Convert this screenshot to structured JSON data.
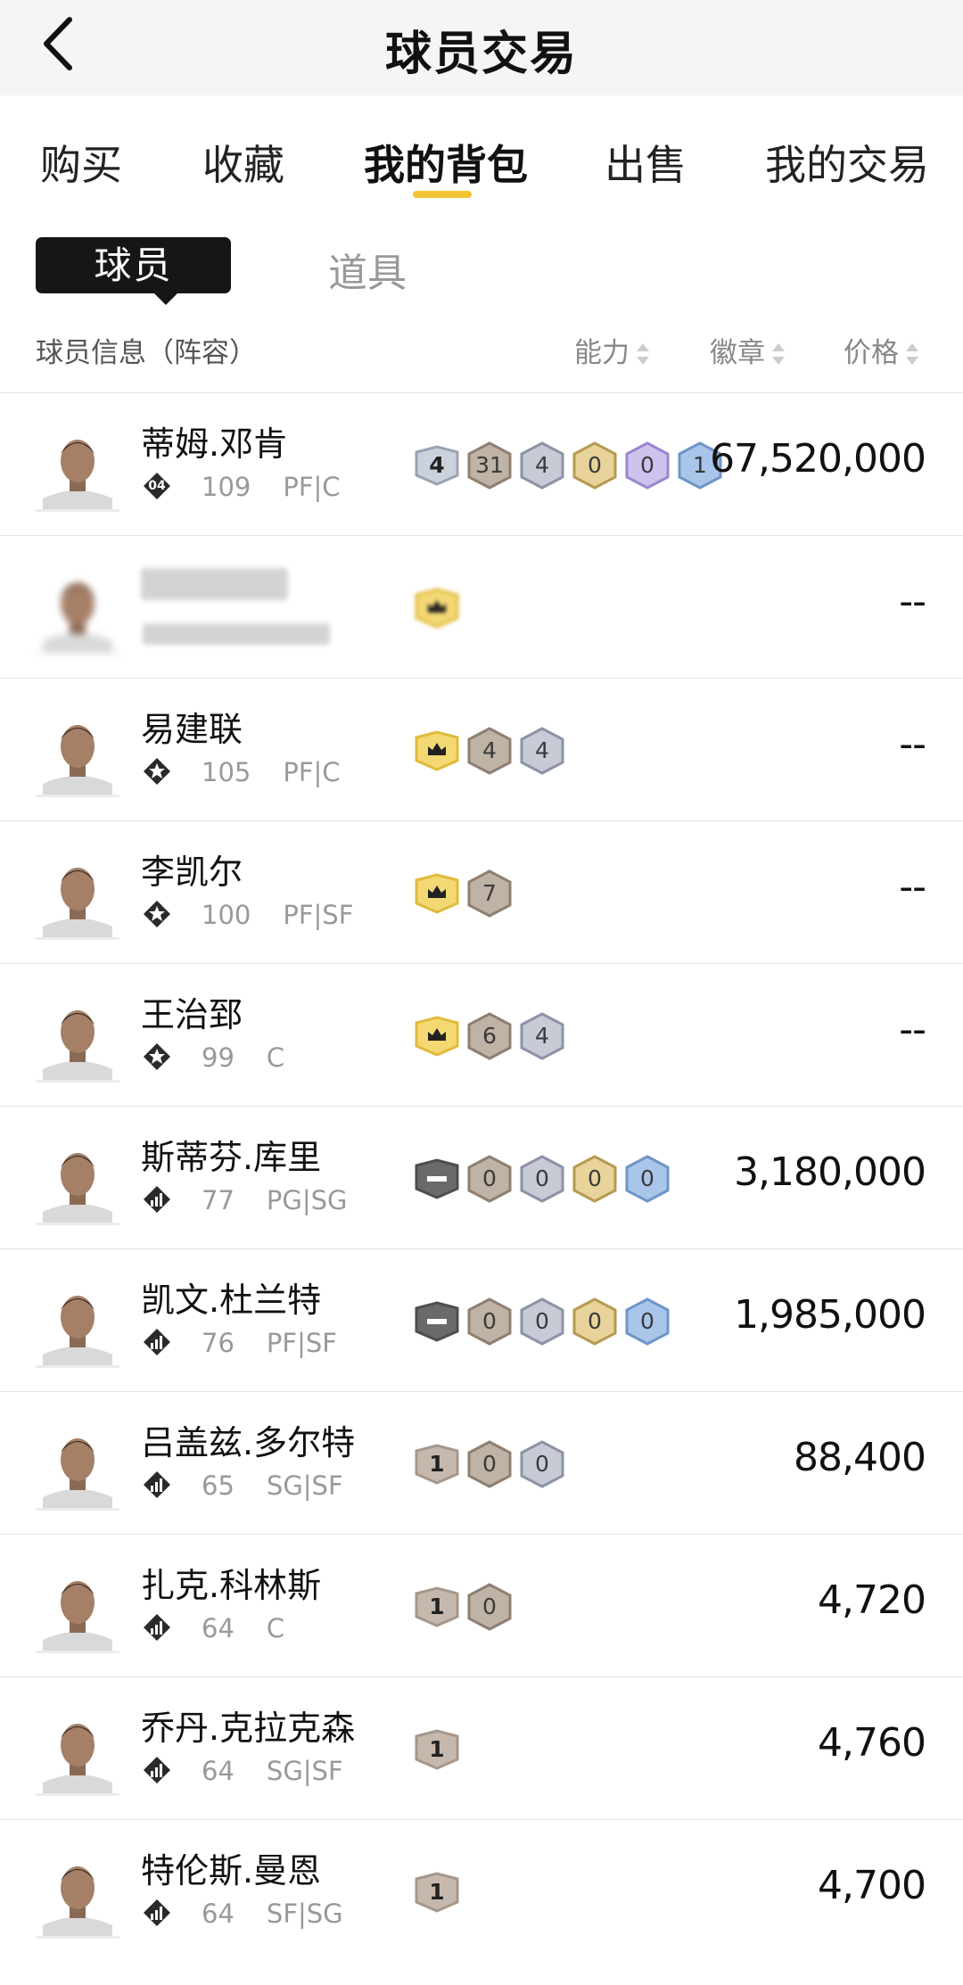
{
  "header": {
    "title": "球员交易"
  },
  "tabs": [
    {
      "label": "购买"
    },
    {
      "label": "收藏"
    },
    {
      "label": "我的背包"
    },
    {
      "label": "出售"
    },
    {
      "label": "我的交易"
    }
  ],
  "subtabs": [
    {
      "label": "球员"
    },
    {
      "label": "道具"
    }
  ],
  "columns": {
    "info": "球员信息（阵容）",
    "ability": "能力",
    "badges": "徽章",
    "price": "价格"
  },
  "colors": {
    "accent": "#f4c433"
  },
  "players": [
    {
      "name": "蒂姆.邓肯",
      "rating": "109",
      "position": "PF|C",
      "tier_icon": "tier-04-icon",
      "tier_text": "04",
      "price": "67,520,000",
      "badges": [
        {
          "type": "level",
          "text": "4"
        },
        {
          "type": "bronze",
          "text": "31"
        },
        {
          "type": "silver",
          "text": "4"
        },
        {
          "type": "gold",
          "text": "0"
        },
        {
          "type": "purple",
          "text": "0"
        },
        {
          "type": "blue",
          "text": "1"
        }
      ]
    },
    {
      "name": "",
      "rating": "",
      "position": "",
      "tier_icon": "tier-icon",
      "tier_text": "",
      "price": "--",
      "blurred": true,
      "badges": [
        {
          "type": "crown",
          "text": ""
        }
      ]
    },
    {
      "name": "易建联",
      "rating": "105",
      "position": "PF|C",
      "tier_icon": "star-tier-icon",
      "tier_text": "",
      "price": "--",
      "badges": [
        {
          "type": "crown",
          "text": ""
        },
        {
          "type": "bronze",
          "text": "4"
        },
        {
          "type": "silver",
          "text": "4"
        }
      ]
    },
    {
      "name": "李凯尔",
      "rating": "100",
      "position": "PF|SF",
      "tier_icon": "star-tier-icon",
      "tier_text": "",
      "price": "--",
      "badges": [
        {
          "type": "crown",
          "text": ""
        },
        {
          "type": "bronze",
          "text": "7"
        }
      ]
    },
    {
      "name": "王治郅",
      "rating": "99",
      "position": "C",
      "tier_icon": "star-tier-icon",
      "tier_text": "",
      "price": "--",
      "badges": [
        {
          "type": "crown",
          "text": ""
        },
        {
          "type": "bronze",
          "text": "6"
        },
        {
          "type": "silver",
          "text": "4"
        }
      ]
    },
    {
      "name": "斯蒂芬.库里",
      "rating": "77",
      "position": "PG|SG",
      "tier_icon": "bars-tier-icon",
      "tier_text": "",
      "price": "3,180,000",
      "badges": [
        {
          "type": "dash",
          "text": ""
        },
        {
          "type": "bronze",
          "text": "0"
        },
        {
          "type": "silver",
          "text": "0"
        },
        {
          "type": "gold",
          "text": "0"
        },
        {
          "type": "blue",
          "text": "0"
        }
      ]
    },
    {
      "name": "凯文.杜兰特",
      "rating": "76",
      "position": "PF|SF",
      "tier_icon": "bars-tier-icon",
      "tier_text": "",
      "price": "1,985,000",
      "badges": [
        {
          "type": "dash",
          "text": ""
        },
        {
          "type": "bronze",
          "text": "0"
        },
        {
          "type": "silver",
          "text": "0"
        },
        {
          "type": "gold",
          "text": "0"
        },
        {
          "type": "blue",
          "text": "0"
        }
      ]
    },
    {
      "name": "吕盖兹.多尔特",
      "rating": "65",
      "position": "SG|SF",
      "tier_icon": "bars-tier-icon",
      "tier_text": "",
      "price": "88,400",
      "badges": [
        {
          "type": "level-bronze",
          "text": "1"
        },
        {
          "type": "bronze",
          "text": "0"
        },
        {
          "type": "silver",
          "text": "0"
        }
      ]
    },
    {
      "name": "扎克.科林斯",
      "rating": "64",
      "position": "C",
      "tier_icon": "bars-tier-icon",
      "tier_text": "",
      "price": "4,720",
      "badges": [
        {
          "type": "level-bronze",
          "text": "1"
        },
        {
          "type": "bronze",
          "text": "0"
        }
      ]
    },
    {
      "name": "乔丹.克拉克森",
      "rating": "64",
      "position": "SG|SF",
      "tier_icon": "bars-tier-icon",
      "tier_text": "",
      "price": "4,760",
      "badges": [
        {
          "type": "level-bronze",
          "text": "1"
        }
      ]
    },
    {
      "name": "特伦斯.曼恩",
      "rating": "64",
      "position": "SF|SG",
      "tier_icon": "bars-tier-icon",
      "tier_text": "",
      "price": "4,700",
      "badges": [
        {
          "type": "level-bronze",
          "text": "1"
        }
      ]
    }
  ]
}
